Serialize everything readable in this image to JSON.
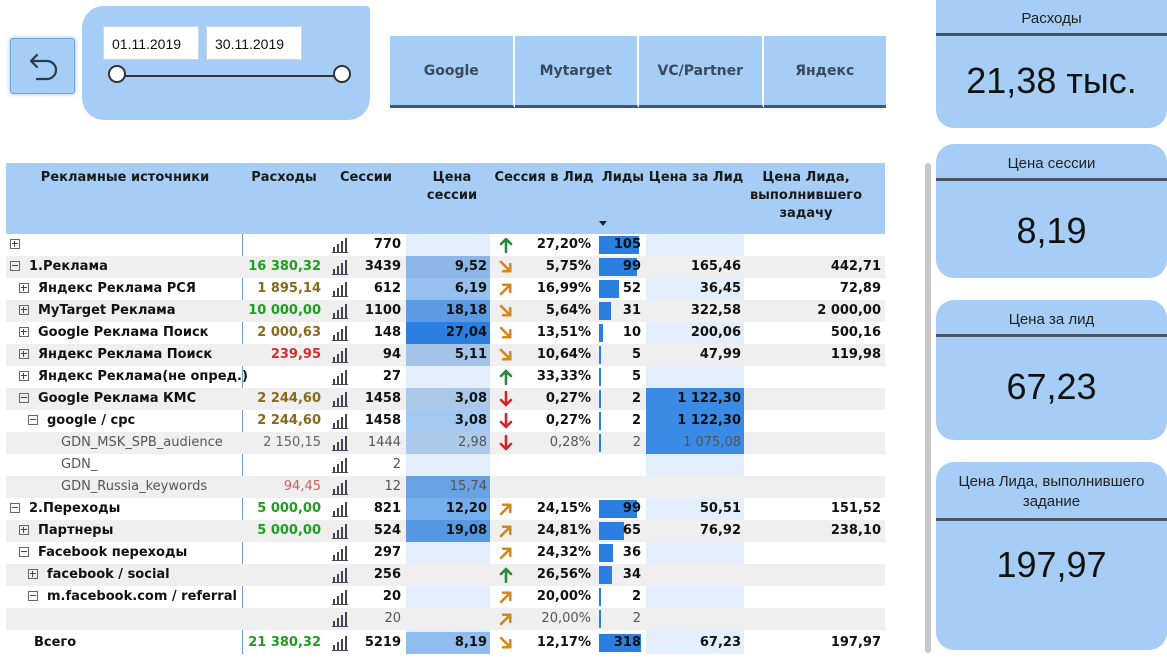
{
  "dates": {
    "start": "01.11.2019",
    "end": "30.11.2019"
  },
  "sources": [
    "Google",
    "Mytarget",
    "VC/Partner",
    "Яндекс"
  ],
  "headers": {
    "source": "Рекламные источники",
    "spend": "Расходы",
    "sessions": "Сессии",
    "session_price": "Цена сессии",
    "conv": "Сессия в Лид",
    "leads": "Лиды",
    "lead_price": "Цена за Лид",
    "task_price": "Цена Лида, выполнившего задачу"
  },
  "rows": [
    {
      "indent": 0,
      "exp": "plus",
      "name": "",
      "spend": "",
      "sessions": "770",
      "sprice": "",
      "conv": "27,20%",
      "arrow": "up",
      "leads": "105",
      "lprice": "",
      "tprice": "",
      "bold": true
    },
    {
      "indent": 0,
      "exp": "minus",
      "name": "1.Реклама",
      "spend": "16 380,32",
      "spendColor": "green",
      "sessions": "3439",
      "sprice": "9,52",
      "conv": "5,75%",
      "arrow": "down-right",
      "leads": "99",
      "lprice": "165,46",
      "tprice": "442,71",
      "bold": true
    },
    {
      "indent": 1,
      "exp": "plus",
      "name": "Яндекс Реклама РСЯ",
      "spend": "1 895,14",
      "spendColor": "olive",
      "sessions": "612",
      "sprice": "6,19",
      "conv": "16,99%",
      "arrow": "up-right",
      "leads": "52",
      "lprice": "36,45",
      "tprice": "72,89",
      "bold": true
    },
    {
      "indent": 1,
      "exp": "plus",
      "name": "MyTarget Реклама",
      "spend": "10 000,00",
      "spendColor": "green",
      "sessions": "1100",
      "sprice": "18,18",
      "conv": "5,64%",
      "arrow": "down-right",
      "leads": "31",
      "lprice": "322,58",
      "tprice": "2 000,00",
      "bold": true
    },
    {
      "indent": 1,
      "exp": "plus",
      "name": "Google Реклама Поиск",
      "spend": "2 000,63",
      "spendColor": "olive",
      "sessions": "148",
      "sprice": "27,04",
      "conv": "13,51%",
      "arrow": "down-right",
      "leads": "10",
      "lprice": "200,06",
      "tprice": "500,16",
      "bold": true
    },
    {
      "indent": 1,
      "exp": "plus",
      "name": "Яндекс Реклама Поиск",
      "spend": "239,95",
      "spendColor": "red",
      "sessions": "94",
      "sprice": "5,11",
      "conv": "10,64%",
      "arrow": "down-right",
      "leads": "5",
      "lprice": "47,99",
      "tprice": "119,98",
      "bold": true
    },
    {
      "indent": 1,
      "exp": "plus",
      "name": "Яндекс Реклама(не опред.)",
      "spend": "",
      "sessions": "27",
      "sprice": "",
      "conv": "33,33%",
      "arrow": "up",
      "leads": "5",
      "lprice": "",
      "tprice": "",
      "bold": true
    },
    {
      "indent": 1,
      "exp": "minus",
      "name": "Google Реклама КМС",
      "spend": "2 244,60",
      "spendColor": "olive",
      "sessions": "1458",
      "sprice": "3,08",
      "conv": "0,27%",
      "arrow": "down",
      "leads": "2",
      "lprice": "1 122,30",
      "tprice": "",
      "bold": true
    },
    {
      "indent": 2,
      "exp": "minus",
      "name": "google / cpc",
      "spend": "2 244,60",
      "spendColor": "olive",
      "sessions": "1458",
      "sprice": "3,08",
      "conv": "0,27%",
      "arrow": "down",
      "leads": "2",
      "lprice": "1 122,30",
      "tprice": "",
      "bold": true
    },
    {
      "indent": 3,
      "exp": "",
      "name": "GDN_MSK_SPB_audience",
      "spend": "2 150,15",
      "spendColor": "gray",
      "sessions": "1444",
      "sprice": "2,98",
      "conv": "0,28%",
      "arrow": "down",
      "leads": "2",
      "lprice": "1 075,08",
      "tprice": "",
      "bold": false
    },
    {
      "indent": 3,
      "exp": "",
      "name": "GDN_",
      "spend": "",
      "sessions": "2",
      "sprice": "",
      "conv": "",
      "arrow": "",
      "leads": "",
      "lprice": "",
      "tprice": "",
      "bold": false
    },
    {
      "indent": 3,
      "exp": "",
      "name": "GDN_Russia_keywords",
      "spend": "94,45",
      "spendColor": "lred",
      "sessions": "12",
      "sprice": "15,74",
      "conv": "",
      "arrow": "",
      "leads": "",
      "lprice": "",
      "tprice": "",
      "bold": false
    },
    {
      "indent": 0,
      "exp": "minus",
      "name": "2.Переходы",
      "spend": "5 000,00",
      "spendColor": "green",
      "sessions": "821",
      "sprice": "12,20",
      "conv": "24,15%",
      "arrow": "up-right",
      "leads": "99",
      "lprice": "50,51",
      "tprice": "151,52",
      "bold": true
    },
    {
      "indent": 1,
      "exp": "plus",
      "name": "Партнеры",
      "spend": "5 000,00",
      "spendColor": "green",
      "sessions": "524",
      "sprice": "19,08",
      "conv": "24,81%",
      "arrow": "up-right",
      "leads": "65",
      "lprice": "76,92",
      "tprice": "238,10",
      "bold": true
    },
    {
      "indent": 1,
      "exp": "minus",
      "name": "Facebook переходы",
      "spend": "",
      "sessions": "297",
      "sprice": "",
      "conv": "24,32%",
      "arrow": "up-right",
      "leads": "36",
      "lprice": "",
      "tprice": "",
      "bold": true
    },
    {
      "indent": 2,
      "exp": "plus",
      "name": "facebook / social",
      "spend": "",
      "sessions": "256",
      "sprice": "",
      "conv": "26,56%",
      "arrow": "up",
      "leads": "34",
      "lprice": "",
      "tprice": "",
      "bold": true
    },
    {
      "indent": 2,
      "exp": "minus",
      "name": "m.facebook.com / referral",
      "spend": "",
      "sessions": "20",
      "sprice": "",
      "conv": "20,00%",
      "arrow": "up-right",
      "leads": "2",
      "lprice": "",
      "tprice": "",
      "bold": true
    },
    {
      "indent": 3,
      "exp": "",
      "name": "",
      "spend": "",
      "sessions": "20",
      "sprice": "",
      "conv": "20,00%",
      "arrow": "up-right",
      "leads": "2",
      "lprice": "",
      "tprice": "",
      "bold": false
    }
  ],
  "total": {
    "name": "Всего",
    "spend": "21 380,32",
    "sessions": "5219",
    "sprice": "8,19",
    "conv": "12,17%",
    "leads": "318",
    "lprice": "67,23",
    "tprice": "197,97"
  },
  "kpi": [
    {
      "title": "Расходы",
      "value": "21,38 тыс."
    },
    {
      "title": "Цена сессии",
      "value": "8,19"
    },
    {
      "title": "Цена за лид",
      "value": "67,23"
    },
    {
      "title": "Цена Лида, выполнившего задание",
      "value": "197,97"
    }
  ],
  "colors": {
    "panel": "#a5cdf6",
    "bar": "#2b7fe0",
    "green": "#1e9e1e",
    "red": "#d03030"
  }
}
